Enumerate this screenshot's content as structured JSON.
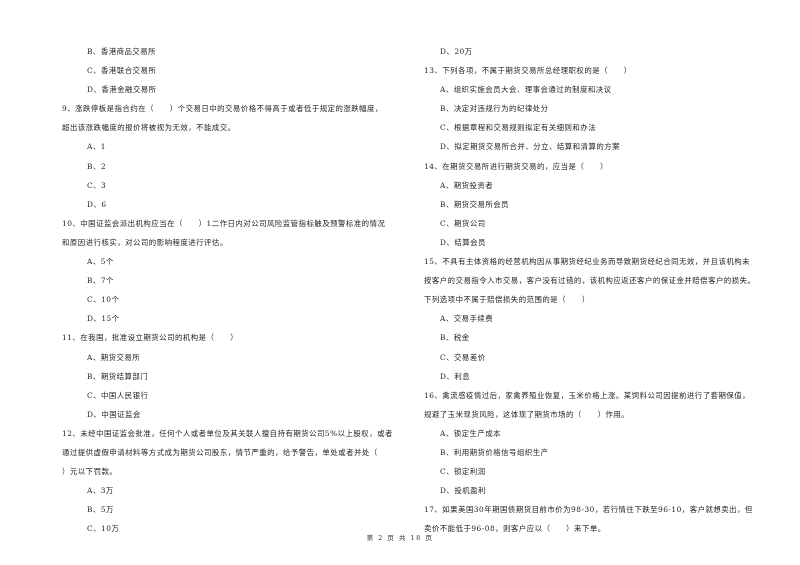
{
  "left_column": [
    {
      "type": "option",
      "text": "B、香港商品交易所"
    },
    {
      "type": "option",
      "text": "C、香港联合交易所"
    },
    {
      "type": "option",
      "text": "D、香港金融交易所"
    },
    {
      "type": "question",
      "text": "9、涨跌停板是指合约在（　　）个交易日中的交易价格不得高于或者低于规定的涨跌幅度，"
    },
    {
      "type": "question-cont",
      "text": "超出该涨跌幅度的报价将被视为无效，不能成交。"
    },
    {
      "type": "option",
      "text": "A、1"
    },
    {
      "type": "option",
      "text": "B、2"
    },
    {
      "type": "option",
      "text": "C、3"
    },
    {
      "type": "option",
      "text": "D、6"
    },
    {
      "type": "question",
      "text": "10、中国证监会派出机构应当在（　　）1二作日内对公司风险监管指标触及预警标准的情况"
    },
    {
      "type": "question-cont",
      "text": "和原因进行核实，对公司的影响程度进行评估。"
    },
    {
      "type": "option",
      "text": "A、5个"
    },
    {
      "type": "option",
      "text": "B、7个"
    },
    {
      "type": "option",
      "text": "C、10个"
    },
    {
      "type": "option",
      "text": "D、15个"
    },
    {
      "type": "question",
      "text": "11、在我国，批准设立期货公司的机构是（　　）"
    },
    {
      "type": "option",
      "text": "A、期货交易所"
    },
    {
      "type": "option",
      "text": "B、期货结算部门"
    },
    {
      "type": "option",
      "text": "C、中国人民银行"
    },
    {
      "type": "option",
      "text": "D、中国证监会"
    },
    {
      "type": "question",
      "text": "12、未经中国证监会批准，任何个人或者单位及其关联人擅自持有期货公司5%以上股权，或者"
    },
    {
      "type": "question-cont",
      "text": "通过提供虚假申请材料等方式成为期货公司股东，情节严重的，给予警告，单处或者并处（"
    },
    {
      "type": "question-cont",
      "text": "）元以下罚款。"
    },
    {
      "type": "option",
      "text": "A、3万"
    },
    {
      "type": "option",
      "text": "B、5万"
    },
    {
      "type": "option",
      "text": "C、10万"
    }
  ],
  "right_column": [
    {
      "type": "option",
      "text": "D、20万"
    },
    {
      "type": "question",
      "text": "13、下列各项，不属于期货交易所总经理职权的是（　　）"
    },
    {
      "type": "option",
      "text": "A、组织实施会员大会、理事会通过的制度和决议"
    },
    {
      "type": "option",
      "text": "B、决定对违规行为的纪律处分"
    },
    {
      "type": "option",
      "text": "C、根据章程和交易规则拟定有关细则和办法"
    },
    {
      "type": "option",
      "text": "D、拟定期货交易所合并、分立、结算和清算的方案"
    },
    {
      "type": "question",
      "text": "14、在期货交易所进行期货交易的，应当是（　　）"
    },
    {
      "type": "option",
      "text": "A、期货投资者"
    },
    {
      "type": "option",
      "text": "B、期货交易所会员"
    },
    {
      "type": "option",
      "text": "C、期货公司"
    },
    {
      "type": "option",
      "text": "D、结算会员"
    },
    {
      "type": "question",
      "text": "15、不具有主体资格的经营机构因从事期货经纪业务而导致期货经纪合同无效，并且该机构未"
    },
    {
      "type": "question-cont",
      "text": "按客户的交易指令入市交易，客户没有过错的，该机构应返还客户的保证金并赔偿客户的损失。"
    },
    {
      "type": "question-cont",
      "text": "下列选项中不属于赔偿损失的范围的是（　　）"
    },
    {
      "type": "option",
      "text": "A、交易手续费"
    },
    {
      "type": "option",
      "text": "B、税金"
    },
    {
      "type": "option",
      "text": "C、交易差价"
    },
    {
      "type": "option",
      "text": "D、利息"
    },
    {
      "type": "question",
      "text": "16、禽流感疫情过后，家禽养殖业恢复，玉米价格上涨。某饲料公司因提前进行了套期保值，"
    },
    {
      "type": "question-cont",
      "text": "规避了玉米现货风险，这体现了期货市场的（　　）作用。"
    },
    {
      "type": "option",
      "text": "A、锁定生产成本"
    },
    {
      "type": "option",
      "text": "B、利用期货价格信号组织生产"
    },
    {
      "type": "option",
      "text": "C、锁定利润"
    },
    {
      "type": "option",
      "text": "D、投机盈利"
    },
    {
      "type": "question",
      "text": "17、如果美国30年期国债期货目前市价为98-30，若行情往下跌至96-10，客户就想卖出，但"
    },
    {
      "type": "question-cont",
      "text": "卖价不能低于96-08，则客户应以（　　）来下单。"
    }
  ],
  "footer": {
    "text": "第 2 页 共 18 页"
  }
}
